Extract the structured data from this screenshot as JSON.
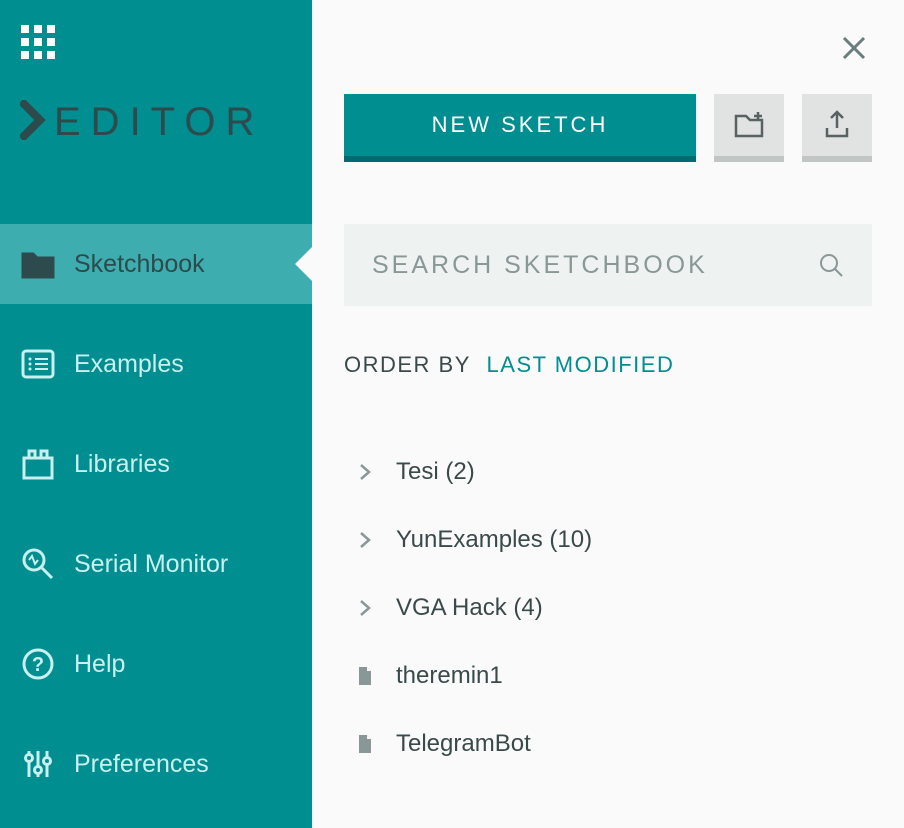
{
  "header": {
    "title": "EDITOR"
  },
  "sidebar": {
    "items": [
      {
        "label": "Sketchbook"
      },
      {
        "label": "Examples"
      },
      {
        "label": "Libraries"
      },
      {
        "label": "Serial Monitor"
      },
      {
        "label": "Help"
      },
      {
        "label": "Preferences"
      }
    ]
  },
  "actions": {
    "new_sketch_label": "NEW SKETCH"
  },
  "search": {
    "placeholder": "SEARCH SKETCHBOOK"
  },
  "order": {
    "label": "ORDER BY",
    "value": "LAST MODIFIED"
  },
  "sketchbook": {
    "items": [
      {
        "type": "folder",
        "label": "Tesi (2)"
      },
      {
        "type": "folder",
        "label": "YunExamples (10)"
      },
      {
        "type": "folder",
        "label": "VGA Hack (4)"
      },
      {
        "type": "file",
        "label": "theremin1"
      },
      {
        "type": "file",
        "label": "TelegramBot"
      }
    ]
  }
}
